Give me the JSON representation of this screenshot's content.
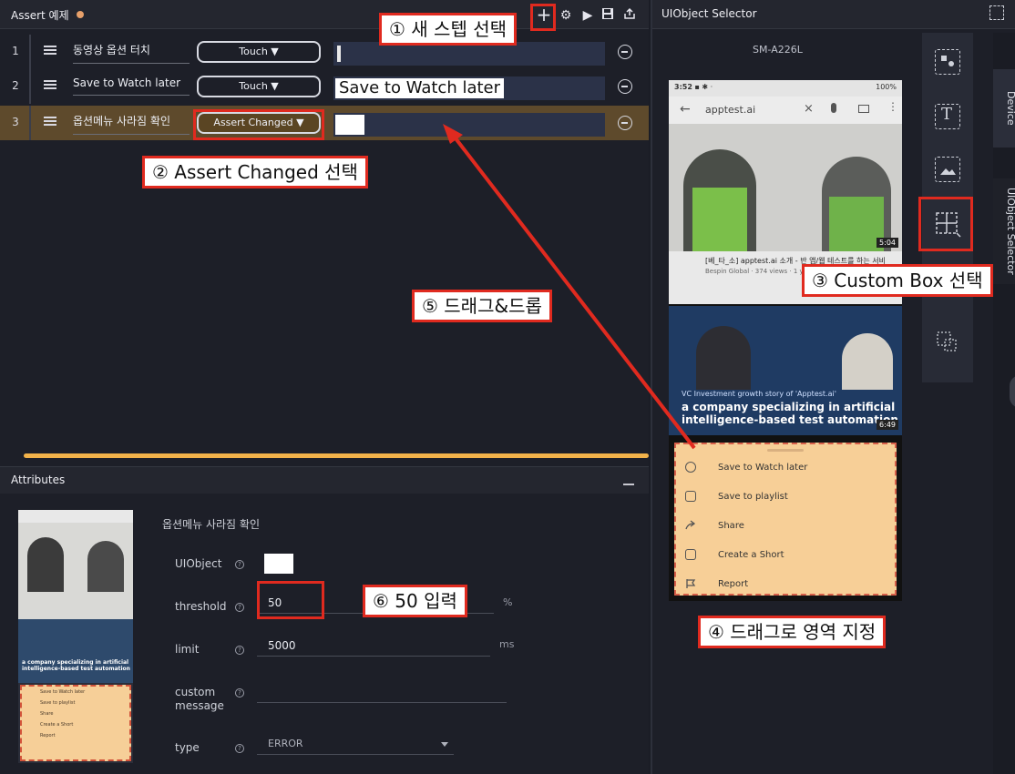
{
  "app": {
    "editor_title": "Assert 예제",
    "attributes_title": "Attributes",
    "selector_title": "UIObject Selector",
    "device_name": "SM-A226L",
    "side_tabs": [
      "Device",
      "UIObject Selector"
    ]
  },
  "toolbar": {
    "add_icon": "plus-icon",
    "settings_icon": "gear-icon",
    "play_icon": "play-icon",
    "save_icon": "save-icon",
    "export_icon": "export-icon"
  },
  "steps": [
    {
      "num": "1",
      "name": "동영상 옵션 터치",
      "action": "Touch ▼",
      "value": "",
      "active": false
    },
    {
      "num": "2",
      "name": "Save to Watch later",
      "action": "Touch ▼",
      "value": "Save to Watch later",
      "active": false
    },
    {
      "num": "3",
      "name": "옵션메뉴 사라짐 확인",
      "action": "Assert Changed ▼",
      "value": "",
      "active": true
    }
  ],
  "attributes": {
    "step_name": "옵션메뉴 사라짐 확인",
    "fields": [
      {
        "label": "UIObject",
        "value": ""
      },
      {
        "label": "threshold",
        "value": "50",
        "unit": "%"
      },
      {
        "label": "limit",
        "value": "5000",
        "unit": "ms"
      },
      {
        "label": "custom message",
        "value": ""
      },
      {
        "label": "type",
        "value": "ERROR"
      }
    ],
    "thumb_menu": [
      "Save to Watch later",
      "Save to playlist",
      "Share",
      "Create a Short",
      "Report"
    ]
  },
  "phone": {
    "status_time": "3:52",
    "status_battery": "100%",
    "search_text": "apptest.ai",
    "video1_duration": "5:04",
    "video1_title": "[베_타_소] apptest.ai 소개 - 반 앱/웹 테스트를 하는 서비",
    "video1_meta": "Bespin Global · 374 views · 1 y",
    "video2_caption": "VC Investment growth story of 'Apptest.ai'",
    "video2_title": "a company specializing in artificial intelligence-based test automation",
    "video2_duration": "6:49",
    "menu_items": [
      "Save to Watch later",
      "Save to playlist",
      "Share",
      "Create a Short",
      "Report"
    ]
  },
  "annotations": {
    "a1": "① 새 스텝 선택",
    "a2": "② Assert Changed 선택",
    "a3": "③ Custom Box 선택",
    "a4": "④ 드래그로 영역 지정",
    "a5": "⑤ 드래그&드롭",
    "a6": "⑥ 50 입력"
  },
  "colors": {
    "annotation_red": "#e02a1f",
    "active_row": "#5e4a2c",
    "progress": "#f2b24a",
    "selection_fill": "#f7cf97"
  }
}
